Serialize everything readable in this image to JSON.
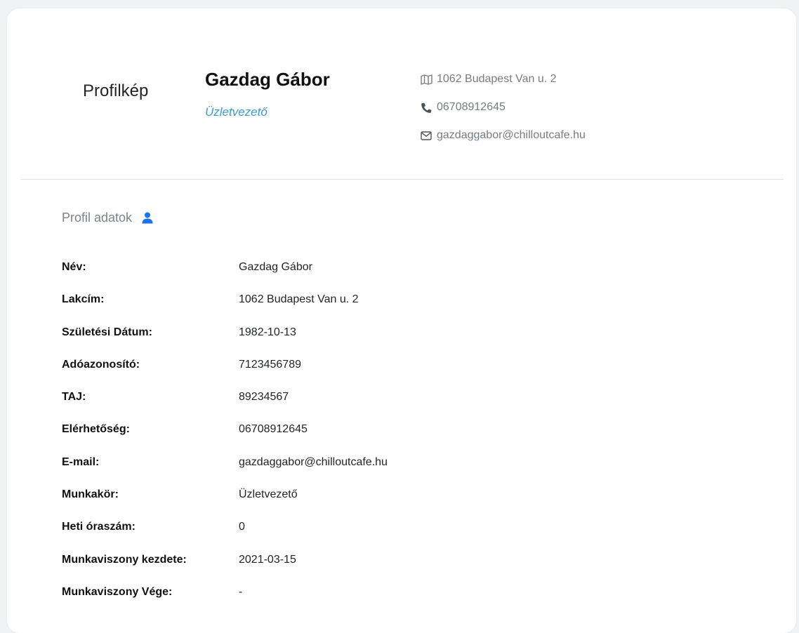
{
  "header": {
    "profile_picture_label": "Profilkép",
    "name": "Gazdag Gábor",
    "role": "Üzletvezető",
    "contact": {
      "address": "1062 Budapest Van u. 2",
      "phone": "06708912645",
      "email": "gazdaggabor@chilloutcafe.hu"
    }
  },
  "icons": {
    "address": "map-icon",
    "phone": "phone-icon",
    "email": "envelope-icon",
    "section": "user-icon"
  },
  "colors": {
    "accent": "#3c9ad6",
    "icon_blue": "#1a73e8",
    "muted": "#777d84"
  },
  "section": {
    "title": "Profil adatok"
  },
  "details": [
    {
      "label": "Név:",
      "value": "Gazdag Gábor"
    },
    {
      "label": "Lakcím:",
      "value": "1062 Budapest Van u. 2"
    },
    {
      "label": "Születési Dátum:",
      "value": "1982-10-13"
    },
    {
      "label": "Adóazonosító:",
      "value": "7123456789"
    },
    {
      "label": "TAJ:",
      "value": "89234567"
    },
    {
      "label": "Elérhetőség:",
      "value": "06708912645"
    },
    {
      "label": "E-mail:",
      "value": "gazdaggabor@chilloutcafe.hu"
    },
    {
      "label": "Munkakör:",
      "value": "Üzletvezető"
    },
    {
      "label": "Heti óraszám:",
      "value": "0"
    },
    {
      "label": "Munkaviszony kezdete:",
      "value": "2021-03-15"
    },
    {
      "label": "Munkaviszony Vége:",
      "value": "-"
    }
  ]
}
